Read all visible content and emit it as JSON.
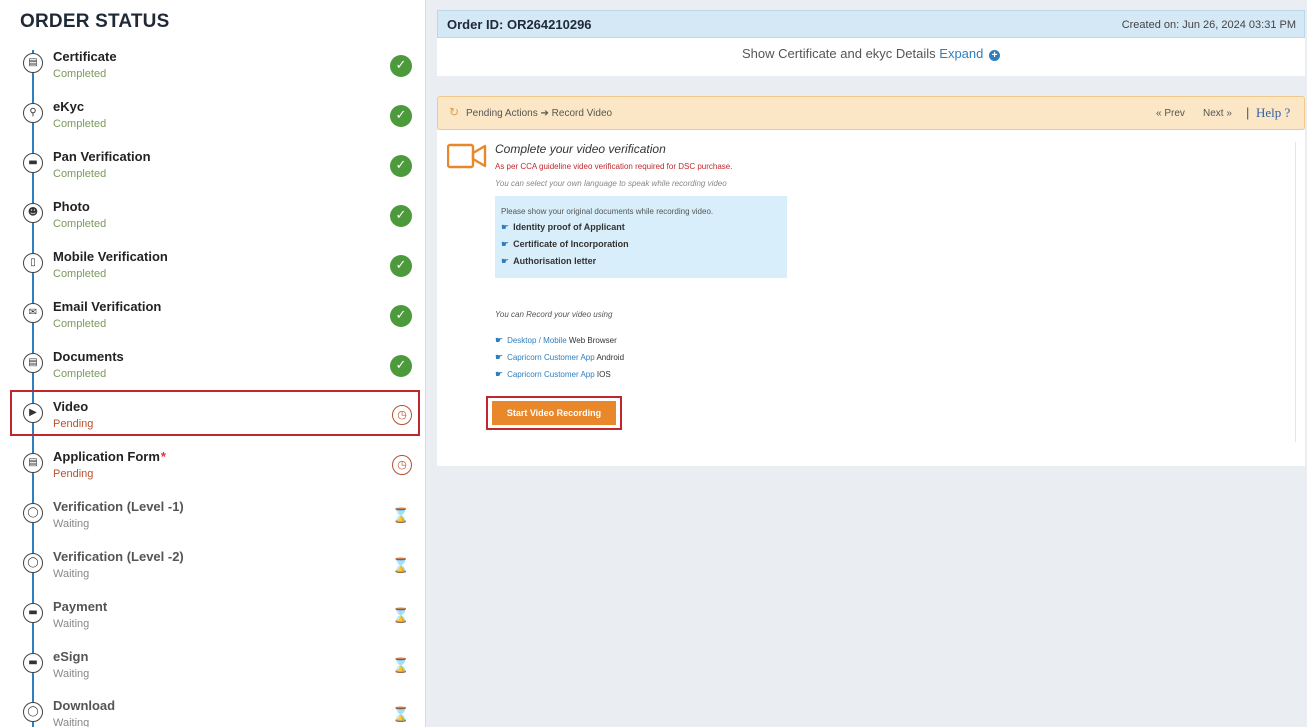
{
  "sidebar": {
    "title": "ORDER STATUS",
    "steps": [
      {
        "name": "Certificate",
        "status": "Completed",
        "icon": "certificate-icon",
        "state": "done"
      },
      {
        "name": "eKyc",
        "status": "Completed",
        "icon": "search-icon",
        "state": "done"
      },
      {
        "name": "Pan Verification",
        "status": "Completed",
        "icon": "card-icon",
        "state": "done"
      },
      {
        "name": "Photo",
        "status": "Completed",
        "icon": "face-icon",
        "state": "done"
      },
      {
        "name": "Mobile Verification",
        "status": "Completed",
        "icon": "mobile-icon",
        "state": "done"
      },
      {
        "name": "Email Verification",
        "status": "Completed",
        "icon": "email-icon",
        "state": "done"
      },
      {
        "name": "Documents",
        "status": "Completed",
        "icon": "document-icon",
        "state": "done"
      },
      {
        "name": "Video",
        "status": "Pending",
        "icon": "video-icon",
        "state": "pending"
      },
      {
        "name": "Application Form",
        "status": "Pending",
        "icon": "form-icon",
        "state": "pending",
        "required_mark": "*"
      },
      {
        "name": "Verification (Level -1)",
        "status": "Waiting",
        "icon": "shield-icon",
        "state": "waiting"
      },
      {
        "name": "Verification (Level -2)",
        "status": "Waiting",
        "icon": "shield-icon",
        "state": "waiting"
      },
      {
        "name": "Payment",
        "status": "Waiting",
        "icon": "card-icon",
        "state": "waiting"
      },
      {
        "name": "eSign",
        "status": "Waiting",
        "icon": "card-icon",
        "state": "waiting"
      },
      {
        "name": "Download",
        "status": "Waiting",
        "icon": "shield-icon",
        "state": "waiting"
      }
    ]
  },
  "header": {
    "order_id": "Order ID: OR264210296",
    "created_on": "Created on: Jun 26, 2024 03:31 PM"
  },
  "cert_details": {
    "text": "Show Certificate and ekyc Details",
    "link": "Expand"
  },
  "action_bar": {
    "crumb": "Pending Actions ➔ Record Video",
    "prev": "« Prev",
    "next": "Next »",
    "separator": "|",
    "help": "Help ?"
  },
  "video": {
    "title": "Complete your video verification",
    "guideline": "As per CCA guideline video verification required for DSC purchase.",
    "language_note": "You can select your own language to speak while recording video",
    "docs_intro": "Please show your original documents while recording video.",
    "documents": [
      "Identity proof of Applicant",
      "Certificate of Incorporation",
      "Authorisation letter"
    ],
    "record_intro": "You can Record your video using",
    "record_options": [
      {
        "link": "Desktop / Mobile",
        "rest": " Web Browser"
      },
      {
        "link": "Capricorn Customer App",
        "rest": " Android"
      },
      {
        "link": "Capricorn Customer App",
        "rest": " IOS"
      }
    ],
    "start_button": "Start Video Recording"
  },
  "colors": {
    "completed": "#4c9a3c",
    "pending": "#b5522f",
    "waiting": "#c49a2a",
    "accent": "#2f7fbf",
    "highlight": "#c0272d",
    "button": "#e8882b"
  }
}
